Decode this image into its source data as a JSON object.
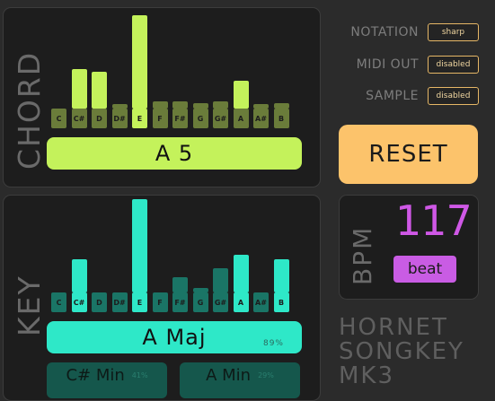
{
  "chord": {
    "section_label": "CHORD",
    "notes": [
      "C",
      "C#",
      "D",
      "D#",
      "E",
      "F",
      "F#",
      "G",
      "G#",
      "A",
      "A#",
      "B"
    ],
    "levels": [
      0.0,
      0.42,
      0.39,
      0.05,
      1.0,
      0.08,
      0.08,
      0.06,
      0.08,
      0.3,
      0.05,
      0.06
    ],
    "active": [
      false,
      false,
      false,
      false,
      true,
      false,
      false,
      false,
      false,
      false,
      false,
      false
    ],
    "result": "A 5",
    "bar_color": "#c4f25b",
    "dim_color": "#6a7c3a"
  },
  "key": {
    "section_label": "KEY",
    "notes": [
      "C",
      "C#",
      "D",
      "D#",
      "E",
      "F",
      "F#",
      "G",
      "G#",
      "A",
      "A#",
      "B"
    ],
    "levels": [
      0.0,
      0.36,
      0.0,
      0.0,
      1.0,
      0.0,
      0.16,
      0.05,
      0.26,
      0.4,
      0.0,
      0.36
    ],
    "active": [
      false,
      true,
      false,
      false,
      true,
      false,
      false,
      false,
      false,
      true,
      false,
      true
    ],
    "result": "A Maj",
    "result_pct": "89%",
    "bar_color": "#2ee8c8",
    "dim_color": "#1a7566",
    "alternatives": [
      {
        "label": "C# Min",
        "pct": "41%"
      },
      {
        "label": "A Min",
        "pct": "29%"
      }
    ]
  },
  "settings": {
    "notation": {
      "label": "NOTATION",
      "value": "sharp"
    },
    "midi_out": {
      "label": "MIDI OUT",
      "value": "disabled"
    },
    "sample": {
      "label": "SAMPLE",
      "value": "disabled"
    }
  },
  "reset_label": "RESET",
  "bpm": {
    "label": "BPM",
    "value": "117",
    "beat_label": "beat"
  },
  "brand": [
    "HORNET",
    "SONGKEY",
    "MK3"
  ]
}
